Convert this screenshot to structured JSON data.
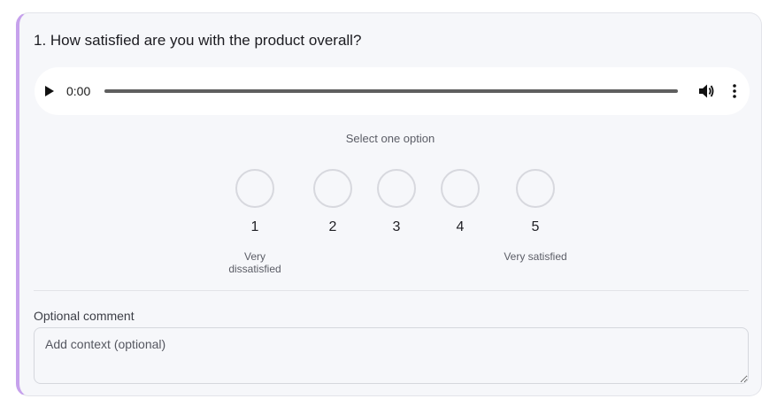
{
  "question": {
    "title": "1. How satisfied are you with the product overall?"
  },
  "audio": {
    "time": "0:00",
    "progress": 0
  },
  "rating": {
    "hint": "Select one option",
    "options": [
      "1",
      "2",
      "3",
      "4",
      "5"
    ],
    "low_label_line1": "Very",
    "low_label_line2": "dissatisfied",
    "high_label": "Very satisfied"
  },
  "comment": {
    "label": "Optional comment",
    "placeholder": "Add context (optional)",
    "value": ""
  },
  "colors": {
    "accent": "#c6a1ec",
    "card_bg": "#f6f7fa"
  }
}
